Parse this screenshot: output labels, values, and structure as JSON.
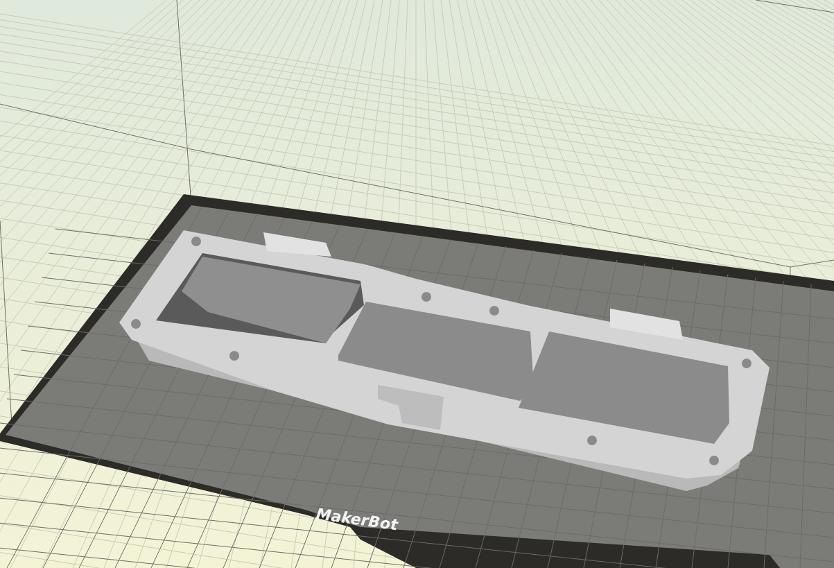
{
  "build_plate": {
    "logo": "MakerBot"
  }
}
